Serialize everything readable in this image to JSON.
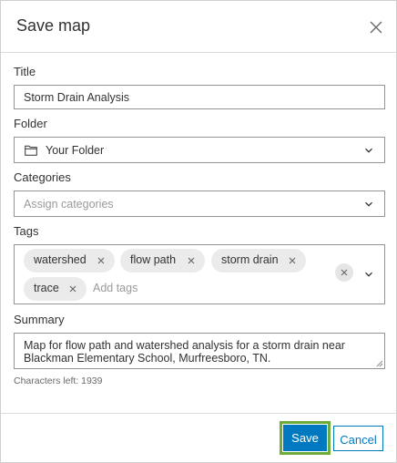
{
  "dialog": {
    "title": "Save map",
    "close_icon": "close-icon"
  },
  "title_field": {
    "label": "Title",
    "value": "Storm Drain Analysis"
  },
  "folder_field": {
    "label": "Folder",
    "value": "Your Folder",
    "icon": "folder-icon"
  },
  "categories_field": {
    "label": "Categories",
    "placeholder": "Assign categories"
  },
  "tags_field": {
    "label": "Tags",
    "tags": [
      "watershed",
      "flow path",
      "storm drain",
      "trace"
    ],
    "placeholder": "Add tags"
  },
  "summary_field": {
    "label": "Summary",
    "value": "Map for flow path and watershed analysis for a storm drain near Blackman Elementary School, Murfreesboro, TN.",
    "characters_left": "Characters left: 1939"
  },
  "footer": {
    "save_label": "Save",
    "cancel_label": "Cancel"
  },
  "colors": {
    "primary": "#0079c1",
    "highlight": "#6dab3a",
    "chip_bg": "#ebebeb"
  }
}
